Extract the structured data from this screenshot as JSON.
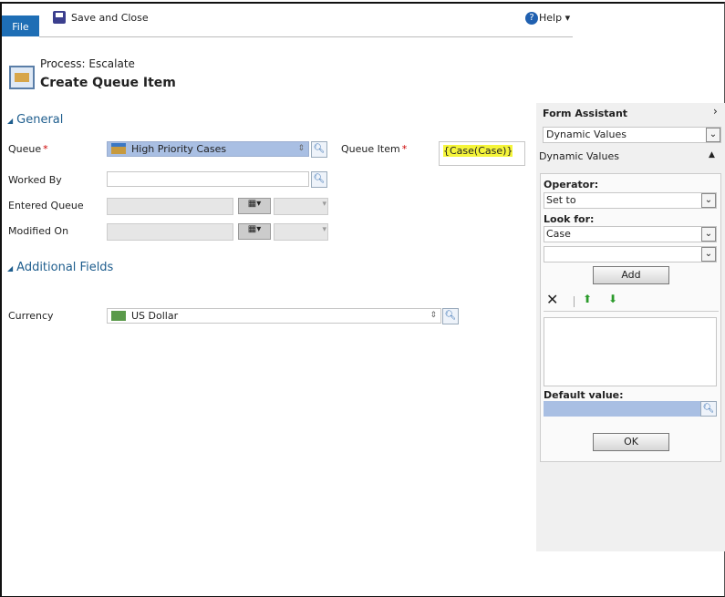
{
  "toolbar": {
    "file": "File",
    "save_close": "Save and Close",
    "help": "Help ▾"
  },
  "header": {
    "process": "Process: Escalate",
    "title": "Create Queue Item"
  },
  "general": {
    "title": "General",
    "queue_label": "Queue",
    "queue_value": "High Priority Cases",
    "queue_item_label": "Queue Item",
    "queue_item_value": "{Case(Case)}",
    "worked_by_label": "Worked By",
    "entered_queue_label": "Entered Queue",
    "modified_on_label": "Modified On",
    "required": "*"
  },
  "additional": {
    "title": "Additional Fields",
    "currency_label": "Currency",
    "currency_value": "US Dollar"
  },
  "assistant": {
    "title": "Form Assistant",
    "select_value": "Dynamic Values",
    "section": "Dynamic Values",
    "operator_label": "Operator:",
    "operator_value": "Set to",
    "look_for_label": "Look for:",
    "look_for_value": "Case",
    "add": "Add",
    "default_label": "Default value:",
    "ok": "OK"
  }
}
